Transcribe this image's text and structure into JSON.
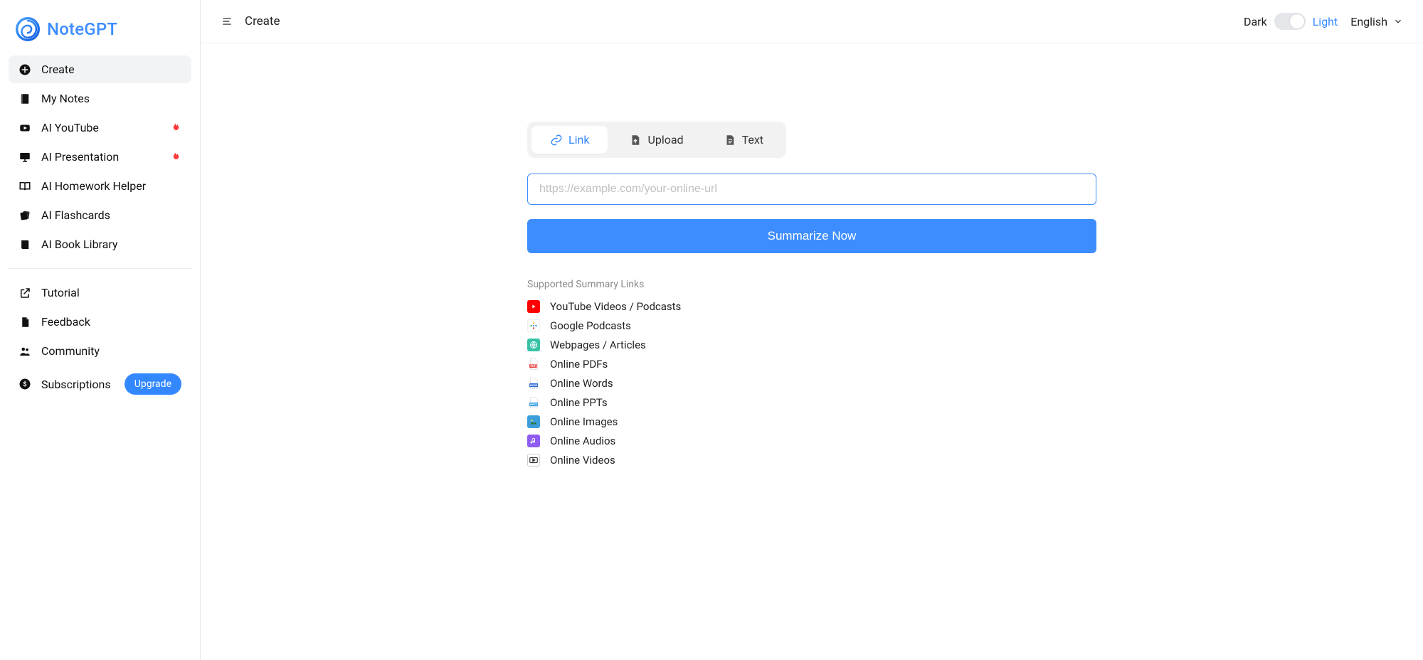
{
  "brand": {
    "name": "NoteGPT"
  },
  "sidebar": {
    "primary": [
      {
        "label": "Create",
        "active": true
      },
      {
        "label": "My Notes"
      },
      {
        "label": "AI YouTube",
        "hot": true
      },
      {
        "label": "AI Presentation",
        "hot": true
      },
      {
        "label": "AI Homework Helper"
      },
      {
        "label": "AI Flashcards"
      },
      {
        "label": "AI Book Library"
      }
    ],
    "secondary": [
      {
        "label": "Tutorial"
      },
      {
        "label": "Feedback"
      },
      {
        "label": "Community"
      },
      {
        "label": "Subscriptions",
        "cta": "Upgrade"
      }
    ]
  },
  "header": {
    "breadcrumb": "Create",
    "theme": {
      "dark": "Dark",
      "light": "Light"
    },
    "language": "English"
  },
  "main": {
    "tabs": [
      {
        "label": "Link",
        "active": true
      },
      {
        "label": "Upload"
      },
      {
        "label": "Text"
      }
    ],
    "url_placeholder": "https://example.com/your-online-url",
    "submit_label": "Summarize Now",
    "supported_title": "Supported Summary Links",
    "supported_items": [
      {
        "label": "YouTube Videos / Podcasts"
      },
      {
        "label": "Google Podcasts"
      },
      {
        "label": "Webpages / Articles"
      },
      {
        "label": "Online PDFs"
      },
      {
        "label": "Online Words"
      },
      {
        "label": "Online PPTs"
      },
      {
        "label": "Online Images"
      },
      {
        "label": "Online Audios"
      },
      {
        "label": "Online Videos"
      }
    ]
  }
}
